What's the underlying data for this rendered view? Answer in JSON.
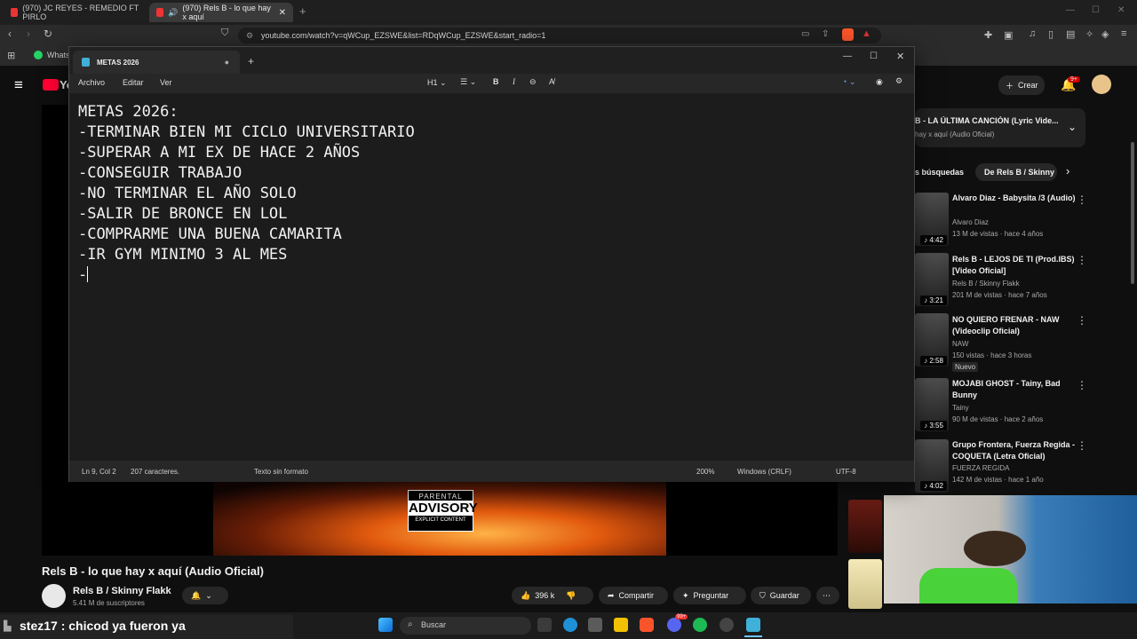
{
  "browser": {
    "tabs": [
      {
        "label": "(970) JC REYES - REMEDIO FT PIRLO"
      },
      {
        "label": "(970) Rels B - lo que hay x aquí"
      }
    ],
    "url": "youtube.com/watch?v=qWCup_EZSWE&list=RDqWCup_EZSWE&start_radio=1",
    "bookmark": "Whats"
  },
  "youtube": {
    "logo_text": "Yo",
    "create_label": "Crear",
    "notif_badge": "9+",
    "playlist_title": "B - LA ÚLTIMA CANCIÓN (Lyric Vide...",
    "playlist_sub": "hay x aquí (Audio Oficial)",
    "chips": [
      "s búsquedas",
      "De Rels B / Skinny F"
    ],
    "recommendations": [
      {
        "title": "Alvaro Diaz - Babysita /3 (Audio)",
        "channel": "Alvaro Diaz",
        "meta": "13 M de vistas · hace 4 años",
        "duration": "4:42",
        "badge": ""
      },
      {
        "title": "Rels B - LEJOS DE TI (Prod.IBS) [Video Oficial]",
        "channel": "Rels B / Skinny Flakk",
        "meta": "201 M de vistas · hace 7 años",
        "duration": "3:21",
        "badge": ""
      },
      {
        "title": "NO QUIERO FRENAR - NAW (Videoclip Oficial)",
        "channel": "NAW",
        "meta": "150 vistas · hace 3 horas",
        "duration": "2:58",
        "badge": "Nuevo"
      },
      {
        "title": "MOJABI GHOST - Tainy, Bad Bunny",
        "channel": "Tainy",
        "meta": "90 M de vistas · hace 2 años",
        "duration": "3:55",
        "badge": ""
      },
      {
        "title": "Grupo Frontera, Fuerza Regida - COQUETA (Letra Oficial)",
        "channel": "FUERZA REGIDA",
        "meta": "142 M de vistas · hace 1 año",
        "duration": "4:02",
        "badge": ""
      }
    ],
    "video_title": "Rels B - lo que hay x aquí (Audio Oficial)",
    "channel_name": "Rels B / Skinny Flakk",
    "subscribers": "5.41 M de suscriptores",
    "likes": "396 k",
    "share_label": "Compartir",
    "ask_label": "Preguntar",
    "save_label": "Guardar",
    "advisory": {
      "top": "PARENTAL",
      "mid": "ADVISORY",
      "bottom": "EXPLICIT CONTENT"
    }
  },
  "notepad": {
    "tab_title": "METAS 2026",
    "menu": [
      "Archivo",
      "Editar",
      "Ver"
    ],
    "heading_select": "H1",
    "lines": [
      "METAS 2026:",
      "-TERMINAR BIEN MI CICLO UNIVERSITARIO",
      "-SUPERAR A MI EX DE HACE 2 AÑOS",
      "-CONSEGUIR TRABAJO",
      "-NO TERMINAR EL AÑO SOLO",
      "-SALIR DE BRONCE EN LOL",
      "-COMPRARME UNA BUENA CAMARITA",
      "-IR GYM MINIMO 3 AL MES",
      "-"
    ],
    "status": {
      "position": "Ln 9, Col 2",
      "chars": "207 caracteres.",
      "format": "Texto sin formato",
      "zoom": "200%",
      "eol": "Windows (CRLF)",
      "encoding": "UTF-8"
    }
  },
  "chat_overlay": "stez17 : chicod ya fueron ya",
  "taskbar": {
    "search_label": "Buscar",
    "badge": "99+"
  },
  "colors": {
    "accent_red": "#ff0033",
    "notepad_bg": "#1c1c1c"
  }
}
